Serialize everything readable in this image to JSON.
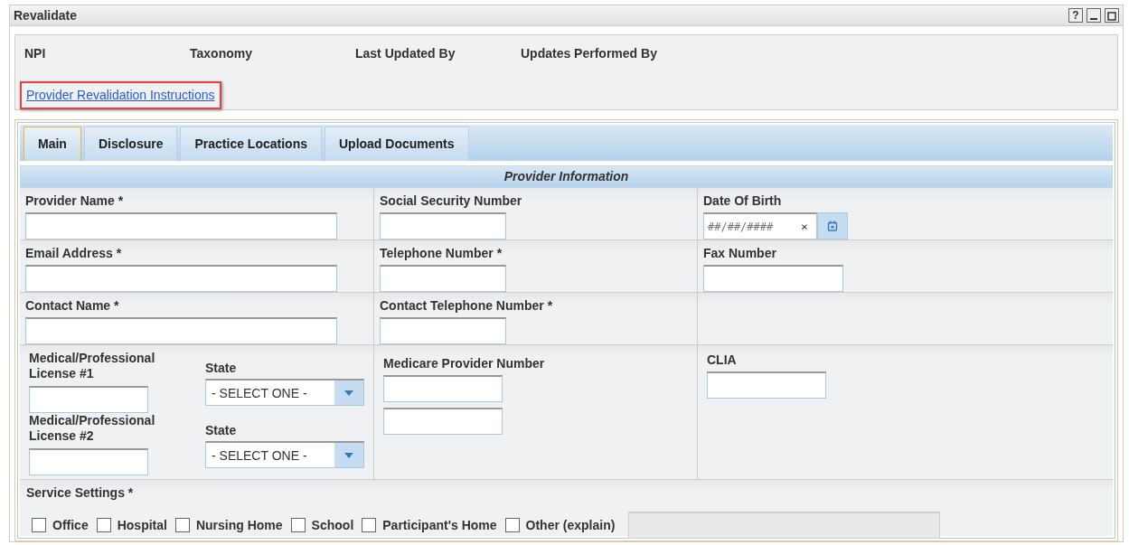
{
  "window": {
    "title": "Revalidate",
    "help": "?"
  },
  "header": {
    "fields": [
      "NPI",
      "Taxonomy",
      "Last Updated By",
      "Updates Performed By"
    ],
    "link": {
      "text": "Provider Revalidation Instructions",
      "highlighted": true
    }
  },
  "tabs": [
    {
      "label": "Main",
      "selected": true
    },
    {
      "label": "Disclosure",
      "selected": false
    },
    {
      "label": "Practice Locations",
      "selected": false
    },
    {
      "label": "Upload Documents",
      "selected": false
    }
  ],
  "section_title": "Provider Information",
  "rows": [
    [
      {
        "label": "Provider Name *",
        "kind": "text"
      },
      {
        "label": "Social Security Number",
        "kind": "text"
      },
      {
        "label": "Date Of Birth",
        "kind": "date",
        "placeholder": "##/##/####",
        "clear": "×"
      }
    ],
    [
      {
        "label": "Email Address *",
        "kind": "text"
      },
      {
        "label": "Telephone Number *",
        "kind": "text"
      },
      {
        "label": "Fax Number",
        "kind": "text"
      }
    ],
    [
      {
        "label": "Contact Name *",
        "kind": "text"
      },
      {
        "label": "Contact Telephone Number *",
        "kind": "text"
      },
      {
        "kind": "empty"
      }
    ]
  ],
  "licenses": [
    {
      "label": "Medical/Professional License #1",
      "state_label": "State",
      "state_value": "- SELECT ONE -"
    },
    {
      "label": "Medical/Professional License #2",
      "state_label": "State",
      "state_value": "- SELECT ONE -"
    }
  ],
  "medicare": {
    "label": "Medicare Provider Number"
  },
  "clia": {
    "label": "CLIA"
  },
  "service_settings": {
    "label": "Service Settings *",
    "options": [
      {
        "label": "Office",
        "checked": false
      },
      {
        "label": "Hospital",
        "checked": false
      },
      {
        "label": "Nursing Home",
        "checked": false
      },
      {
        "label": "School",
        "checked": false
      },
      {
        "label": "Participant's Home",
        "checked": false
      },
      {
        "label": "Other (explain)",
        "checked": false
      }
    ],
    "explain_disabled": true
  }
}
